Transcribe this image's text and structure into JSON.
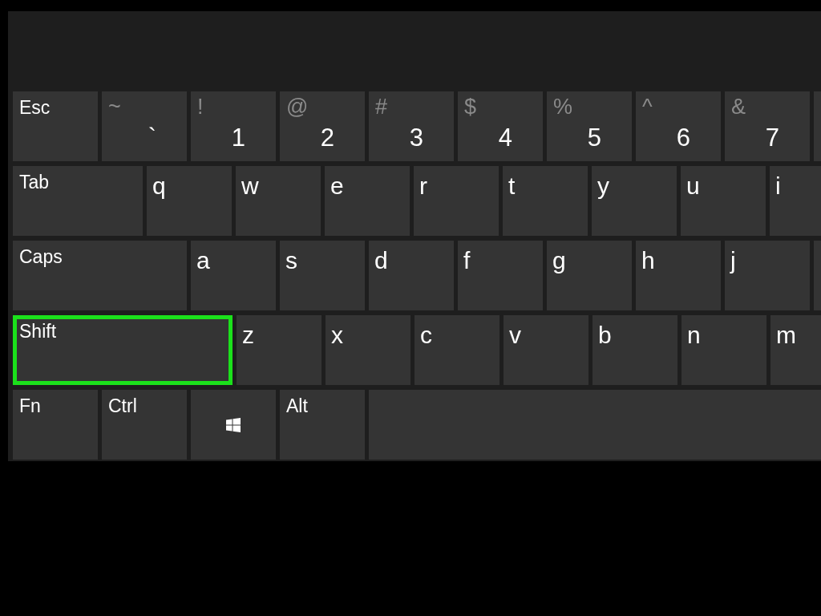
{
  "rows": [
    {
      "keys": [
        {
          "kind": "label",
          "label": "Esc",
          "highlighted": false
        },
        {
          "kind": "dual",
          "shift": "~",
          "label": "`",
          "highlighted": false
        },
        {
          "kind": "dual",
          "shift": "!",
          "label": "1",
          "highlighted": false
        },
        {
          "kind": "dual",
          "shift": "@",
          "label": "2",
          "highlighted": false
        },
        {
          "kind": "dual",
          "shift": "#",
          "label": "3",
          "highlighted": false
        },
        {
          "kind": "dual",
          "shift": "$",
          "label": "4",
          "highlighted": false
        },
        {
          "kind": "dual",
          "shift": "%",
          "label": "5",
          "highlighted": false
        },
        {
          "kind": "dual",
          "shift": "^",
          "label": "6",
          "highlighted": false
        },
        {
          "kind": "dual",
          "shift": "&",
          "label": "7",
          "highlighted": false
        },
        {
          "kind": "blank",
          "highlighted": false
        }
      ]
    },
    {
      "keys": [
        {
          "kind": "tab",
          "label": "Tab",
          "highlighted": false
        },
        {
          "kind": "letter",
          "label": "q",
          "highlighted": false
        },
        {
          "kind": "letter",
          "label": "w",
          "highlighted": false
        },
        {
          "kind": "letter",
          "label": "e",
          "highlighted": false
        },
        {
          "kind": "letter",
          "label": "r",
          "highlighted": false
        },
        {
          "kind": "letter",
          "label": "t",
          "highlighted": false
        },
        {
          "kind": "letter",
          "label": "y",
          "highlighted": false
        },
        {
          "kind": "letter",
          "label": "u",
          "highlighted": false
        },
        {
          "kind": "letter",
          "label": "i",
          "highlighted": false
        }
      ]
    },
    {
      "keys": [
        {
          "kind": "caps",
          "label": "Caps",
          "highlighted": false
        },
        {
          "kind": "letter",
          "label": "a",
          "highlighted": false
        },
        {
          "kind": "letter",
          "label": "s",
          "highlighted": false
        },
        {
          "kind": "letter",
          "label": "d",
          "highlighted": false
        },
        {
          "kind": "letter",
          "label": "f",
          "highlighted": false
        },
        {
          "kind": "letter",
          "label": "g",
          "highlighted": false
        },
        {
          "kind": "letter",
          "label": "h",
          "highlighted": false
        },
        {
          "kind": "letter",
          "label": "j",
          "highlighted": false
        },
        {
          "kind": "blank",
          "highlighted": false
        }
      ]
    },
    {
      "keys": [
        {
          "kind": "shift",
          "label": "Shift",
          "highlighted": true
        },
        {
          "kind": "letter",
          "label": "z",
          "highlighted": false
        },
        {
          "kind": "letter",
          "label": "x",
          "highlighted": false
        },
        {
          "kind": "letter",
          "label": "c",
          "highlighted": false
        },
        {
          "kind": "letter",
          "label": "v",
          "highlighted": false
        },
        {
          "kind": "letter",
          "label": "b",
          "highlighted": false
        },
        {
          "kind": "letter",
          "label": "n",
          "highlighted": false
        },
        {
          "kind": "letter",
          "label": "m",
          "highlighted": false
        }
      ]
    },
    {
      "keys": [
        {
          "kind": "label",
          "label": "Fn",
          "highlighted": false
        },
        {
          "kind": "label",
          "label": "Ctrl",
          "highlighted": false
        },
        {
          "kind": "windows",
          "highlighted": false
        },
        {
          "kind": "label",
          "label": "Alt",
          "highlighted": false
        },
        {
          "kind": "space",
          "highlighted": false
        }
      ]
    }
  ]
}
